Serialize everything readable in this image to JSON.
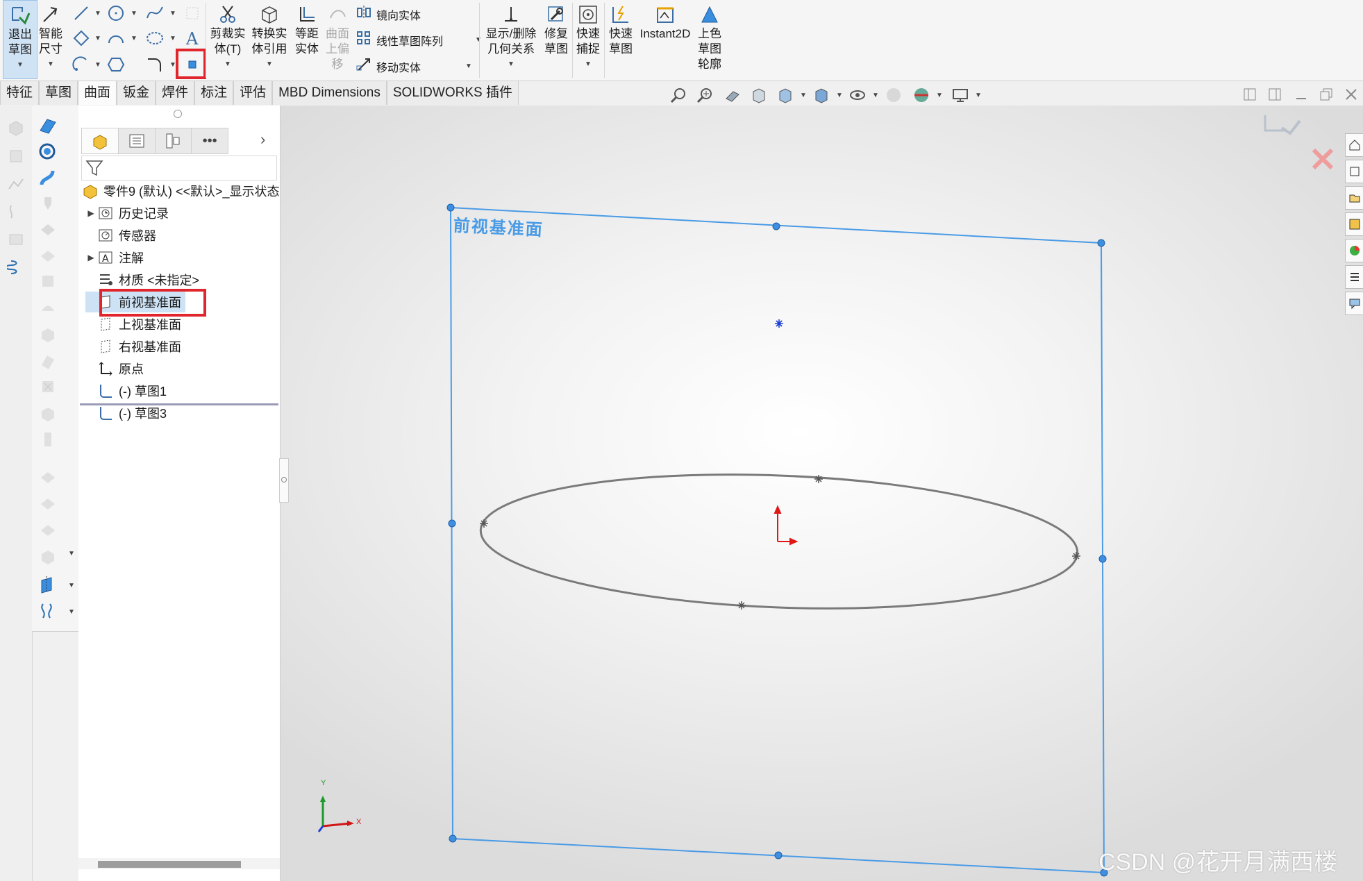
{
  "ribbon": {
    "exit_sketch": "退出\n草图",
    "smart_dim": "智能\n尺寸",
    "trim": "剪裁实\n体(T)",
    "convert": "转换实\n体引用",
    "offset": "等距\n实体",
    "surface_offset": "曲面\n上偏\n移",
    "mirror": "镜向实体",
    "linear_pattern": "线性草图阵列",
    "move": "移动实体",
    "display_relations": "显示/删除\n几何关系",
    "repair": "修复\n草图",
    "quick_snap": "快速\n捕捉",
    "rapid_sketch": "快速\n草图",
    "instant2d": "Instant2D",
    "shaded_contours": "上色\n草图\n轮廓"
  },
  "tabs": [
    "特征",
    "草图",
    "曲面",
    "钣金",
    "焊件",
    "标注",
    "评估",
    "MBD Dimensions",
    "SOLIDWORKS 插件"
  ],
  "active_tab": "曲面",
  "feature_tree": {
    "root": "零件9 (默认) <<默认>_显示状态",
    "items": [
      {
        "label": "历史记录",
        "icon": "history-icon",
        "expandable": true
      },
      {
        "label": "传感器",
        "icon": "sensor-icon",
        "expandable": false
      },
      {
        "label": "注解",
        "icon": "annotation-icon",
        "expandable": true
      },
      {
        "label": "材质 <未指定>",
        "icon": "material-icon",
        "expandable": false
      },
      {
        "label": "前视基准面",
        "icon": "plane-icon",
        "expandable": false,
        "selected": true
      },
      {
        "label": "上视基准面",
        "icon": "plane-icon",
        "expandable": false
      },
      {
        "label": "右视基准面",
        "icon": "plane-icon",
        "expandable": false
      },
      {
        "label": "原点",
        "icon": "origin-icon",
        "expandable": false
      },
      {
        "label": "(-) 草图1",
        "icon": "sketch-icon",
        "expandable": false
      },
      {
        "label": "(-) 草图3",
        "icon": "sketch-icon",
        "expandable": false
      }
    ]
  },
  "viewport": {
    "plane_label": "前视基准面",
    "triad_x": "X",
    "triad_y": "Y",
    "watermark": "CSDN @花开月满西楼"
  },
  "colors": {
    "plane_blue": "#4a9be6",
    "highlight_red": "#e0252c",
    "ellipse_gray": "#7a7a7a",
    "origin_red": "#e01818"
  }
}
